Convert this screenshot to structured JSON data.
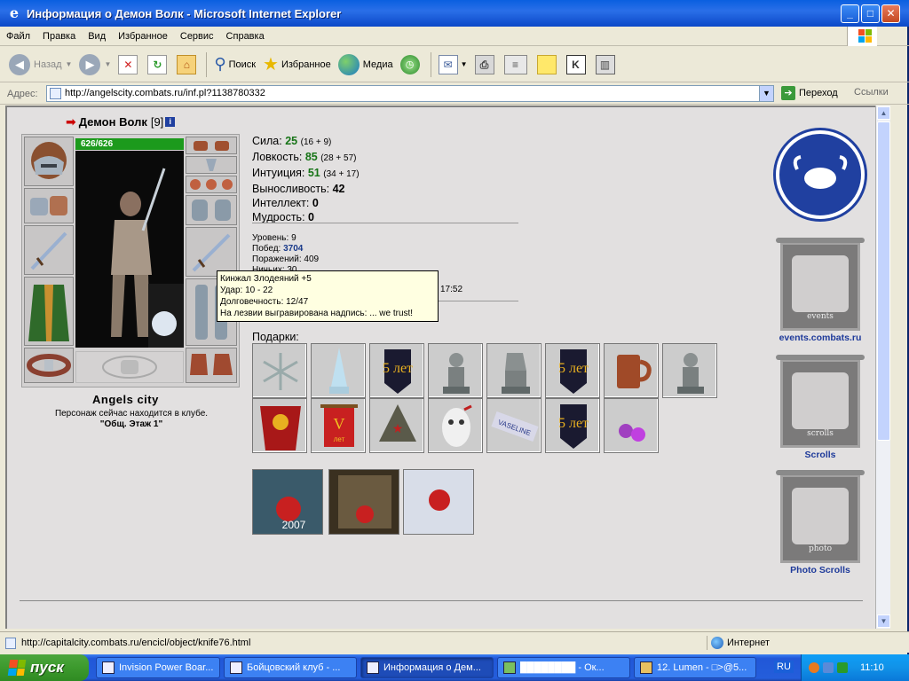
{
  "window": {
    "title": "Информация о Демон Волк - Microsoft Internet Explorer",
    "min": "_",
    "max": "□",
    "close": "✕"
  },
  "menu": [
    "Файл",
    "Правка",
    "Вид",
    "Избранное",
    "Сервис",
    "Справка"
  ],
  "toolbar": {
    "back": "Назад",
    "search": "Поиск",
    "favorites": "Избранное",
    "media": "Медиа"
  },
  "address": {
    "label": "Адрес:",
    "url": "http://angelscity.combats.ru/inf.pl?1138780332",
    "go": "Переход",
    "links": "Ссылки"
  },
  "character": {
    "name": "Демон Волк",
    "level_tag": "[9]",
    "hp": "626/626",
    "city": "Angels city",
    "location_text": "Персонаж сейчас находится в клубе.",
    "location_room": "\"Общ. Этаж 1\""
  },
  "stats": [
    {
      "label": "Сила:",
      "value": "25",
      "sub": "(16 + 9)",
      "green": true
    },
    {
      "label": "Ловкость:",
      "value": "85",
      "sub": "(28 + 57)",
      "green": true
    },
    {
      "label": "Интуиция:",
      "value": "51",
      "sub": "(34 + 17)",
      "green": true
    },
    {
      "label": "Выносливость:",
      "value": "42",
      "sub": "",
      "green": false
    },
    {
      "label": "Интеллект:",
      "value": "0",
      "sub": "",
      "green": false
    },
    {
      "label": "Мудрость:",
      "value": "0",
      "sub": "",
      "green": false
    }
  ],
  "details": {
    "level_label": "Уровень:",
    "level": "9",
    "wins_label": "Побед:",
    "wins": "3704",
    "losses_label": "Поражений:",
    "losses": "409",
    "draws_label": "Ничьих:",
    "draws": "30",
    "time": "17:52"
  },
  "tooltip": {
    "line1": "Кинжал Злодеяний +5",
    "line2": "Удар: 10 - 22",
    "line3": "Долговечность: 12/47",
    "line4": "На лезвии выгравирована надпись: ... we trust!"
  },
  "gifts_label": "Подарки:",
  "gift_labels": {
    "five_years": "5 лет",
    "roman_five": "V",
    "years_short": "лет",
    "vaseline": "VASELINE",
    "year_2007": "2007"
  },
  "banners": {
    "events_text": "events",
    "events_caption": "events.combats.ru",
    "scrolls_text": "scrolls",
    "scrolls_caption": "Scrolls",
    "photo_text": "photo",
    "photo_caption": "Photo Scrolls"
  },
  "statusbar": {
    "url": "http://capitalcity.combats.ru/encicl/object/knife76.html",
    "zone": "Интернет"
  },
  "taskbar": {
    "start": "пуск",
    "tasks": [
      "Invision Power Boar...",
      "Бойцовский клуб - ...",
      "Информация о Дем...",
      "████████ - Ок...",
      "12. Lumen - □>@5..."
    ],
    "lang": "RU",
    "clock": "11:10"
  },
  "colors": {
    "stat_green": "#177417",
    "link_blue": "#1e3a9a",
    "hp_green": "#1c9a1c"
  }
}
